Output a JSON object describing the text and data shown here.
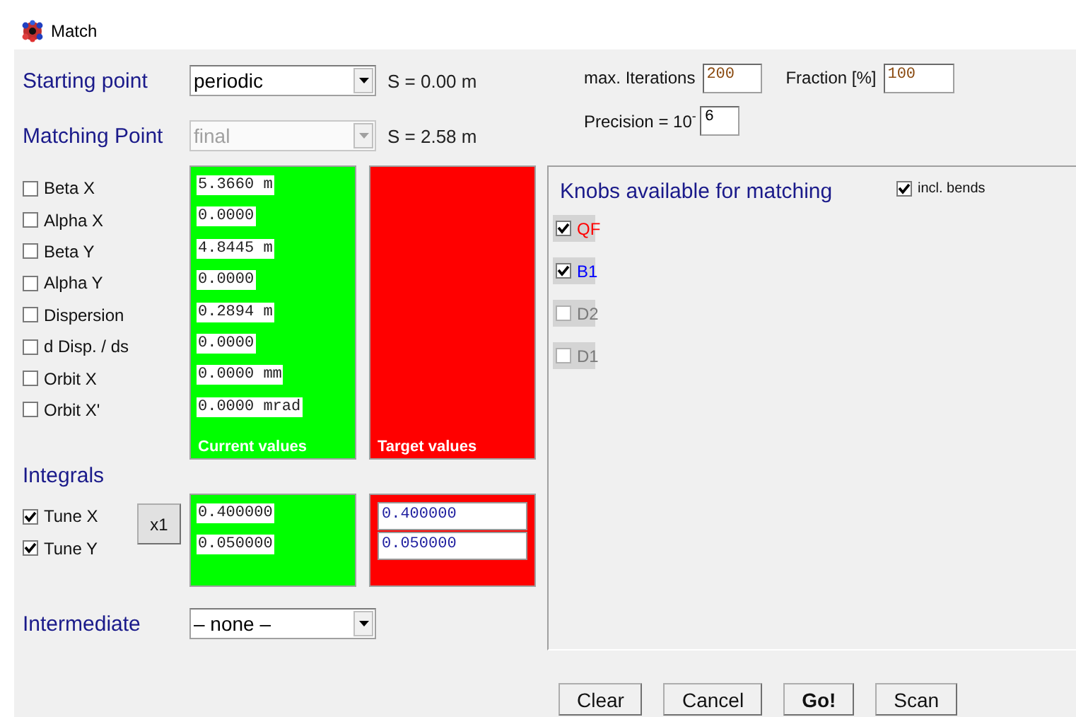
{
  "window": {
    "title": "Match"
  },
  "starting_point": {
    "label": "Starting point",
    "value": "periodic",
    "disabled": false,
    "position": "S = 0.00 m"
  },
  "matching_point": {
    "label": "Matching Point",
    "value": "final",
    "disabled": true,
    "position": "S = 2.58 m"
  },
  "settings": {
    "iterations_label": "max. Iterations",
    "iterations": "200",
    "fraction_label": "Fraction [%]",
    "fraction": "100",
    "precision_label": "Precision  = 10$^{-}$",
    "precision": "6"
  },
  "parameters": [
    {
      "label": "Beta X",
      "checked": false,
      "current": "5.3660 m"
    },
    {
      "label": "Alpha X",
      "checked": false,
      "current": "0.0000"
    },
    {
      "label": "Beta Y",
      "checked": false,
      "current": "4.8445 m"
    },
    {
      "label": "Alpha Y",
      "checked": false,
      "current": "0.0000"
    },
    {
      "label": "Dispersion",
      "checked": false,
      "current": "0.2894 m"
    },
    {
      "label": "d Disp. / ds",
      "checked": false,
      "current": "0.0000"
    },
    {
      "label": "Orbit X",
      "checked": false,
      "current": "0.0000 mm"
    },
    {
      "label": "Orbit X'",
      "checked": false,
      "current": "0.0000 mrad"
    }
  ],
  "current_values_label": "Current values",
  "target_values_label": "Target values",
  "integrals": {
    "title": "Integrals",
    "button": "x1",
    "tunes": [
      {
        "label": "Tune X",
        "checked": true,
        "current": "0.400000",
        "target": "0.400000"
      },
      {
        "label": "Tune Y",
        "checked": true,
        "current": "0.050000",
        "target": "0.050000"
      }
    ]
  },
  "intermediate": {
    "label": "Intermediate",
    "value": "– none –"
  },
  "knobs": {
    "title": "Knobs available for matching",
    "incl_bends": {
      "label": "incl. bends",
      "checked": true
    },
    "items": [
      {
        "label": "QF",
        "checked": true,
        "disabled": false,
        "color": "#ff0000"
      },
      {
        "label": "B1",
        "checked": true,
        "disabled": false,
        "color": "#0000ff"
      },
      {
        "label": "D2",
        "checked": false,
        "disabled": true,
        "color": "#7a7a7a"
      },
      {
        "label": "D1",
        "checked": false,
        "disabled": true,
        "color": "#7a7a7a"
      }
    ]
  },
  "buttons": [
    {
      "label": "Clear",
      "default": false
    },
    {
      "label": "Cancel",
      "default": false
    },
    {
      "label": "Go!",
      "default": true
    },
    {
      "label": "Scan",
      "default": false
    }
  ]
}
